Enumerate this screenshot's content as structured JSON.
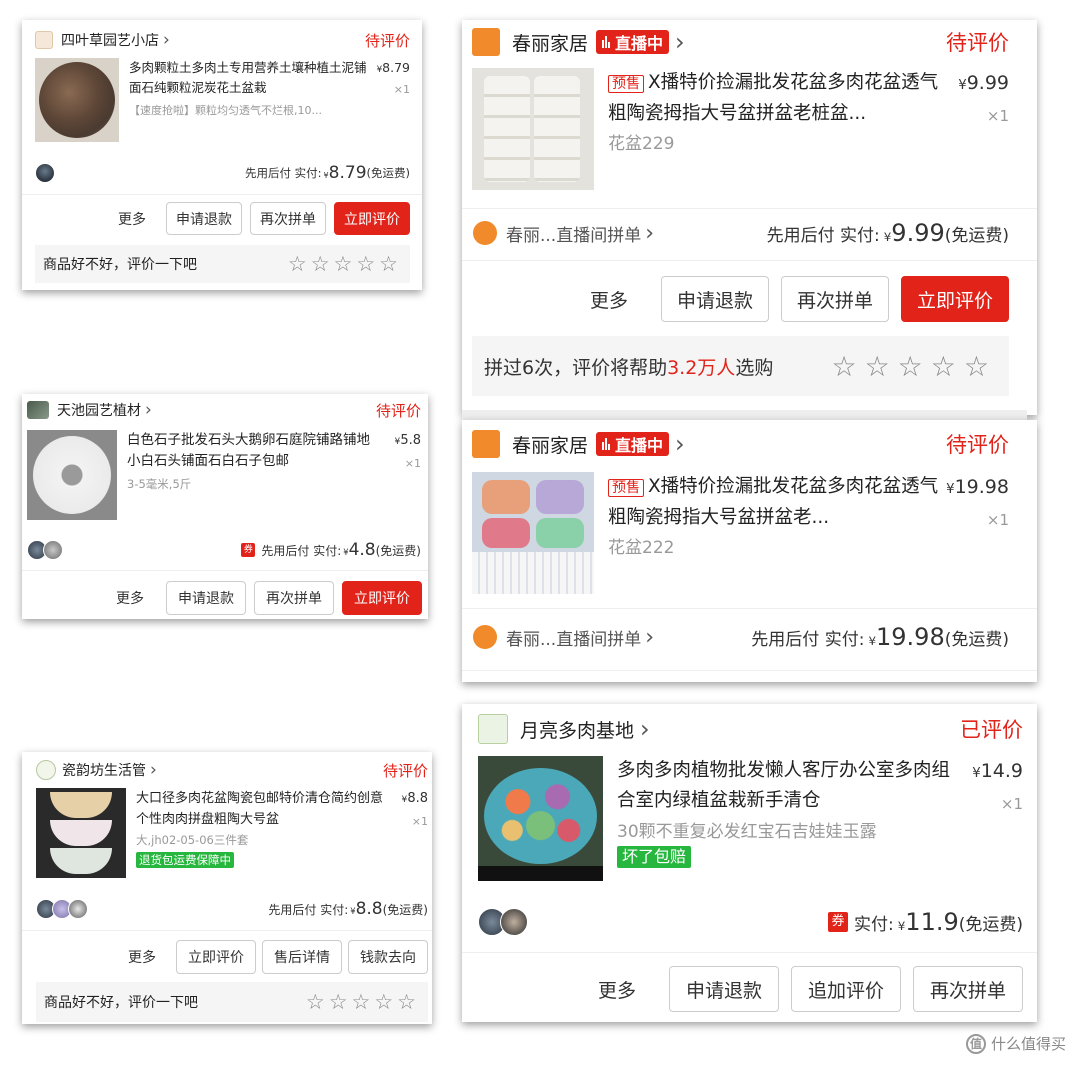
{
  "cards": {
    "c1": {
      "shop_name": "四叶草园艺小店",
      "status": "待评价",
      "product_title": "多肉颗粒土多肉土专用营养土壤种植土泥铺面石纯颗粒泥炭花土盆栽",
      "sku": "【速度抢啦】颗粒均匀透气不烂根,10...",
      "price": "8.79",
      "qty": "×1",
      "pay_label": "先用后付 实付:",
      "pay_amount": "8.79",
      "shipping": "(免运费)",
      "buttons": [
        "更多",
        "申请退款",
        "再次拼单",
        "立即评价"
      ],
      "review_prompt": "商品好不好，评价一下吧"
    },
    "c2": {
      "shop_name": "春丽家居",
      "live_label": "直播中",
      "status": "待评价",
      "presale": "预售",
      "product_title": "X播特价捡漏批发花盆多肉花盆透气粗陶瓷拇指大号盆拼盆老桩盆...",
      "sku": "花盆229",
      "price": "9.99",
      "qty": "×1",
      "group_label": "春丽...直播间拼单",
      "pay_label": "先用后付 实付:",
      "pay_amount": "9.99",
      "shipping": "(免运费)",
      "buttons": [
        "更多",
        "申请退款",
        "再次拼单",
        "立即评价"
      ],
      "review_prefix": "拼过6次，评价将帮助",
      "review_highlight": "3.2万人",
      "review_suffix": "选购"
    },
    "c3": {
      "shop_name": "天池园艺植材",
      "status": "待评价",
      "product_title": "白色石子批发石头大鹅卵石庭院铺路铺地小白石头铺面石白石子包邮",
      "sku": "3-5毫米,5斤",
      "price": "5.8",
      "qty": "×1",
      "coupon": "券",
      "pay_label": "先用后付 实付:",
      "pay_amount": "4.8",
      "shipping": "(免运费)",
      "buttons": [
        "更多",
        "申请退款",
        "再次拼单",
        "立即评价"
      ]
    },
    "c4": {
      "shop_name": "春丽家居",
      "live_label": "直播中",
      "status": "待评价",
      "presale": "预售",
      "product_title": "X播特价捡漏批发花盆多肉花盆透气粗陶瓷拇指大号盆拼盆老...",
      "sku": "花盆222",
      "price": "19.98",
      "qty": "×1",
      "group_label": "春丽...直播间拼单",
      "pay_label": "先用后付 实付:",
      "pay_amount": "19.98",
      "shipping": "(免运费)"
    },
    "c5": {
      "shop_name": "瓷韵坊生活管",
      "status": "待评价",
      "product_title": "大口径多肉花盆陶瓷包邮特价清仓简约创意个性肉肉拼盘粗陶大号盆",
      "sku": "大,jh02-05-06三件套",
      "guarantee": "退货包运费保障中",
      "price": "8.8",
      "qty": "×1",
      "pay_label": "先用后付 实付:",
      "pay_amount": "8.8",
      "shipping": "(免运费)",
      "buttons": [
        "更多",
        "立即评价",
        "售后详情",
        "钱款去向"
      ],
      "review_prompt": "商品好不好，评价一下吧"
    },
    "c6": {
      "shop_name": "月亮多肉基地",
      "status": "已评价",
      "product_title": "多肉多肉植物批发懒人客厅办公室多肉组合室内绿植盆栽新手清仓",
      "sku": "30颗不重复必发红宝石吉娃娃玉露",
      "badge": "坏了包赔",
      "price": "14.9",
      "qty": "×1",
      "coupon": "券",
      "pay_label": "实付:",
      "pay_amount": "11.9",
      "shipping": "(免运费)",
      "buttons": [
        "更多",
        "申请退款",
        "追加评价",
        "再次拼单"
      ]
    }
  },
  "common": {
    "yen": "¥",
    "chevron": "›",
    "star": "☆"
  },
  "watermark": {
    "icon_text": "值",
    "text": "什么值得买"
  },
  "colors": {
    "accent": "#e2231a",
    "green_tag": "#27b63e",
    "muted": "#999999"
  }
}
